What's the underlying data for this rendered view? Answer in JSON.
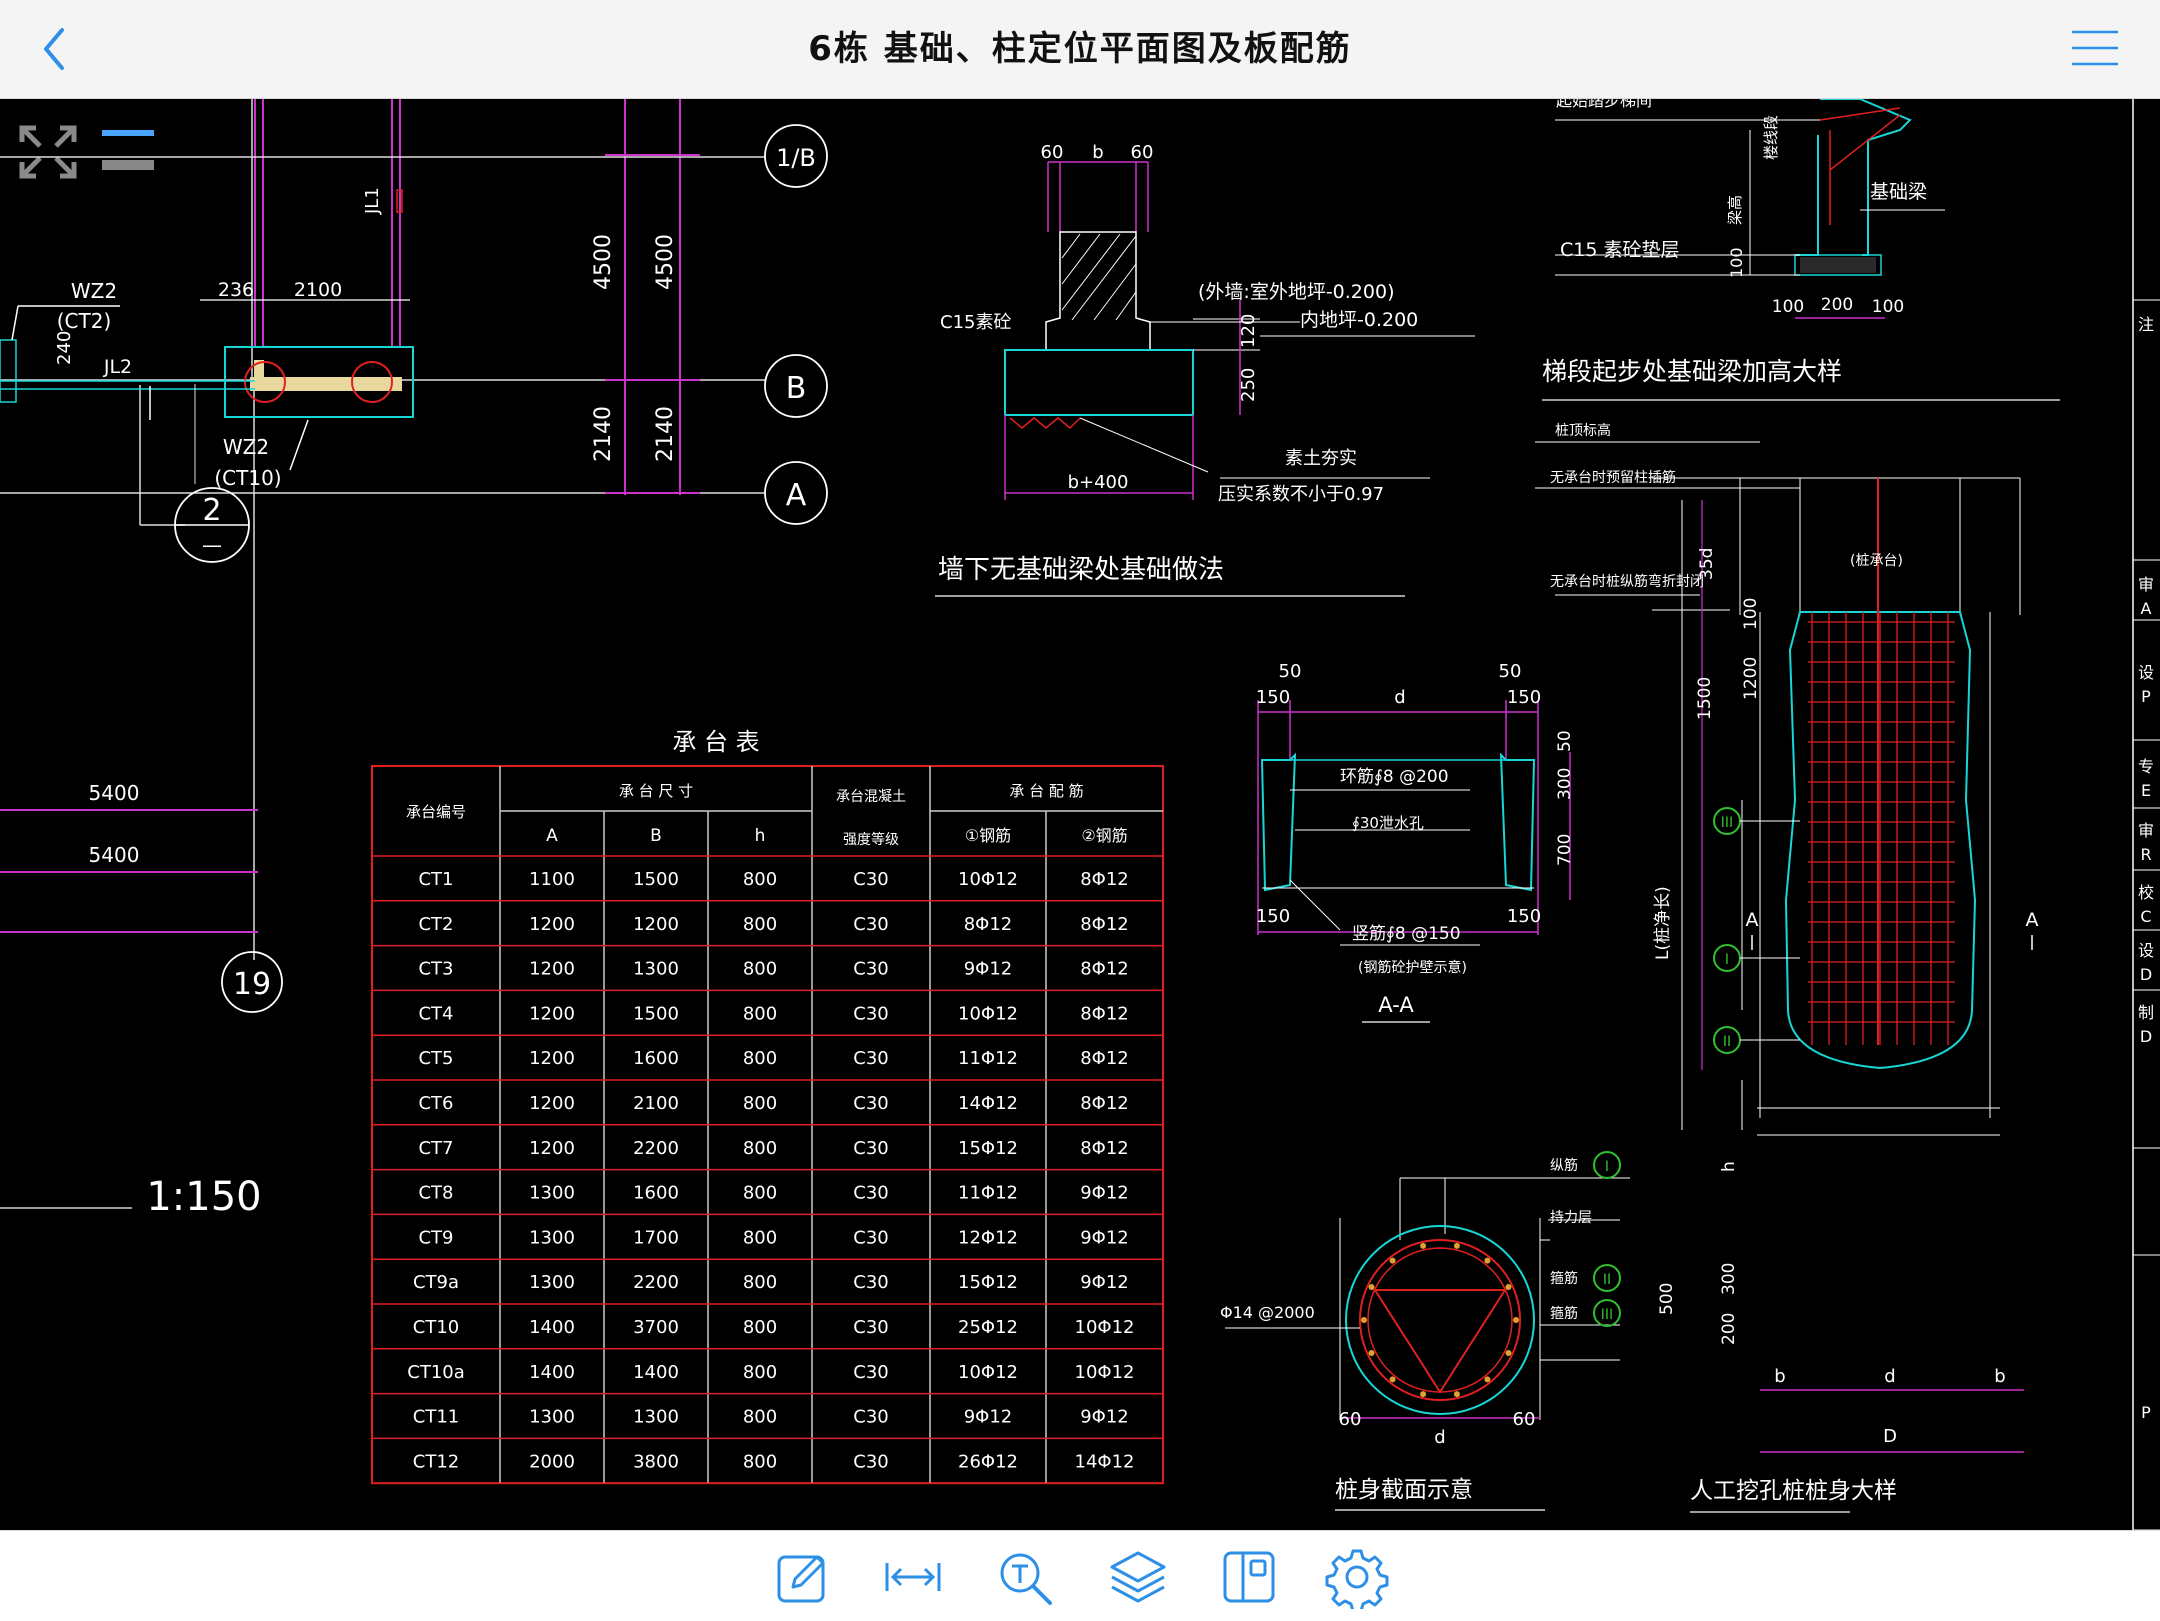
{
  "header": {
    "title": "6栋 基础、柱定位平面图及板配筋"
  },
  "icons": {
    "back": "chevron-left-icon",
    "menu": "hamburger-menu-icon",
    "fullscreen": "expand-arrows-icon",
    "toolbar": [
      "edit-pen-icon",
      "measure-icon",
      "text-search-icon",
      "layers-icon",
      "layout-icon",
      "gear-icon"
    ]
  },
  "colors": {
    "accent": "#2d8fe6",
    "cad_bg": "#000000",
    "cyan": "#18d6d6",
    "magenta": "#cc33cc",
    "red": "#e02020",
    "green": "#30c030"
  },
  "drawing": {
    "axis_labels": [
      "1/B",
      "B",
      "A",
      "19",
      "2"
    ],
    "dims_top": [
      "236",
      "2100",
      "240",
      "4500",
      "4500",
      "2140",
      "2140"
    ],
    "beams": [
      "WZ2",
      "(CT2)",
      "JL2",
      "WZ2",
      "(CT10)",
      "JL1"
    ],
    "dims_left": [
      "5400",
      "5400"
    ],
    "scale": "1:150",
    "section1": {
      "dims": [
        "60",
        "b",
        "60",
        "120",
        "250",
        "b+400"
      ],
      "labels": [
        "C15素砼",
        "(外墙:室外地坪-0.200)",
        "内地坪-0.200",
        "素土夯实",
        "压实系数不小于0.97"
      ],
      "title": "墙下无基础梁处基础做法"
    },
    "section2": {
      "labels": [
        "起始踏步梯间",
        "楼线段",
        "梁高",
        "基础梁",
        "C15 素砼垫层"
      ],
      "dims": [
        "100",
        "100",
        "200",
        "100"
      ],
      "title": "梯段起步处基础梁加高大样"
    },
    "pile": {
      "notes": [
        "无承台时桩纵筋弯折封闭",
        "无承台时预留柱插筋",
        "桩顶标高",
        "(桩承台)"
      ],
      "dims": [
        "35d",
        "100",
        "1200",
        "1500",
        "L(桩净长)",
        "h",
        "500",
        "300",
        "200",
        "b",
        "d",
        "b",
        "D"
      ],
      "marks": [
        "III",
        "I",
        "II"
      ],
      "section_marks": [
        "A",
        "A"
      ],
      "title": "人工挖孔桩桩身大样"
    },
    "aa": {
      "dims": [
        "50",
        "50",
        "150",
        "d",
        "150",
        "50",
        "300",
        "700",
        "150",
        "150"
      ],
      "labels": [
        "环筋∮8 @200",
        "∮30泄水孔",
        "竖筋∮8 @150",
        "(钢筋砼护壁示意)"
      ],
      "title": "A-A"
    },
    "circle": {
      "labels": [
        "纵筋",
        "持力层",
        "箍筋",
        "箍筋",
        "Φ14 @2000"
      ],
      "marks": [
        "I",
        "II",
        "III"
      ],
      "dims": [
        "60",
        "d",
        "60"
      ],
      "title": "桩身截面示意"
    },
    "right_edge": [
      "注",
      "审",
      "A",
      "设",
      "P",
      "专",
      "E",
      "审",
      "R",
      "校",
      "C",
      "设",
      "D",
      "制",
      "D",
      "P"
    ]
  },
  "table": {
    "title": "承 台 表",
    "header": {
      "id": "承台编号",
      "size": "承 台 尺 寸",
      "grade1": "承台混凝土",
      "grade2": "强度等级",
      "rebar": "承 台 配 筋",
      "A": "A",
      "B": "B",
      "h": "h",
      "r1": "①钢筋",
      "r2": "②钢筋"
    },
    "rows": [
      [
        "CT1",
        "1100",
        "1500",
        "800",
        "C30",
        "10Φ12",
        "8Φ12"
      ],
      [
        "CT2",
        "1200",
        "1200",
        "800",
        "C30",
        "8Φ12",
        "8Φ12"
      ],
      [
        "CT3",
        "1200",
        "1300",
        "800",
        "C30",
        "9Φ12",
        "8Φ12"
      ],
      [
        "CT4",
        "1200",
        "1500",
        "800",
        "C30",
        "10Φ12",
        "8Φ12"
      ],
      [
        "CT5",
        "1200",
        "1600",
        "800",
        "C30",
        "11Φ12",
        "8Φ12"
      ],
      [
        "CT6",
        "1200",
        "2100",
        "800",
        "C30",
        "14Φ12",
        "8Φ12"
      ],
      [
        "CT7",
        "1200",
        "2200",
        "800",
        "C30",
        "15Φ12",
        "8Φ12"
      ],
      [
        "CT8",
        "1300",
        "1600",
        "800",
        "C30",
        "11Φ12",
        "9Φ12"
      ],
      [
        "CT9",
        "1300",
        "1700",
        "800",
        "C30",
        "12Φ12",
        "9Φ12"
      ],
      [
        "CT9a",
        "1300",
        "2200",
        "800",
        "C30",
        "15Φ12",
        "9Φ12"
      ],
      [
        "CT10",
        "1400",
        "3700",
        "800",
        "C30",
        "25Φ12",
        "10Φ12"
      ],
      [
        "CT10a",
        "1400",
        "1400",
        "800",
        "C30",
        "10Φ12",
        "10Φ12"
      ],
      [
        "CT11",
        "1300",
        "1300",
        "800",
        "C30",
        "9Φ12",
        "9Φ12"
      ],
      [
        "CT12",
        "2000",
        "3800",
        "800",
        "C30",
        "26Φ12",
        "14Φ12"
      ]
    ]
  }
}
